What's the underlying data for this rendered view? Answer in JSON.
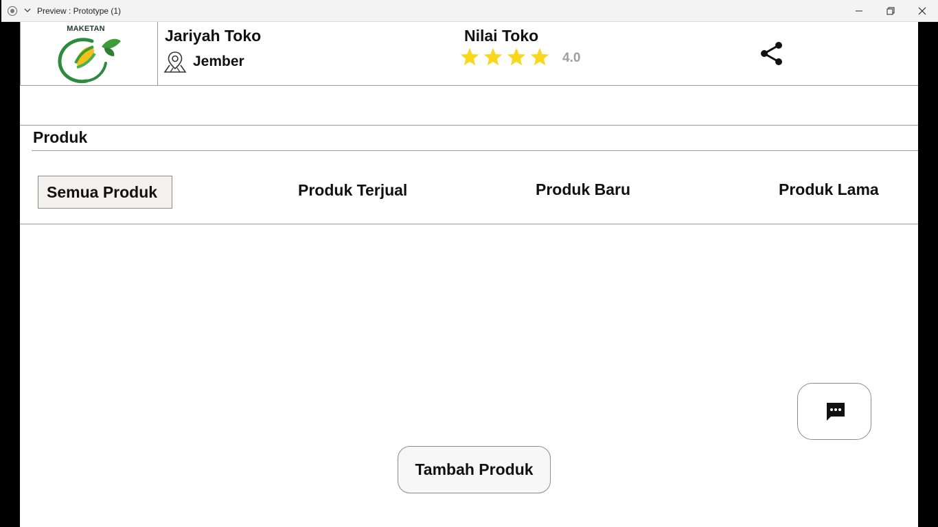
{
  "window": {
    "title": "Preview : Prototype (1)"
  },
  "logo": {
    "text": "MAKETAN"
  },
  "store": {
    "name": "Jariyah Toko",
    "location": "Jember"
  },
  "rating": {
    "label": "Nilai Toko",
    "value": "4.0",
    "stars": 4,
    "star_color": "#f9d71c"
  },
  "section": {
    "title": "Produk"
  },
  "tabs": [
    {
      "label": "Semua Produk",
      "active": true
    },
    {
      "label": "Produk Terjual",
      "active": false
    },
    {
      "label": "Produk Baru",
      "active": false
    },
    {
      "label": "Produk Lama",
      "active": false
    }
  ],
  "actions": {
    "add_product": "Tambah Produk"
  },
  "icons": {
    "location": "map-pin-icon",
    "share": "share-icon",
    "chat": "chat-bubble-icon"
  }
}
